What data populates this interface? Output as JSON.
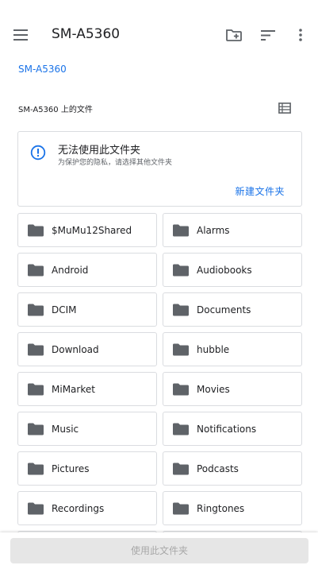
{
  "appbar": {
    "title": "SM-A5360",
    "icons": [
      "menu-icon",
      "new-folder-icon",
      "sort-icon",
      "more-vert-icon"
    ]
  },
  "breadcrumb": "SM-A5360",
  "section": {
    "label": "SM-A5360 上的文件",
    "view_icon": "list-view-icon"
  },
  "notice": {
    "icon": "info-icon",
    "title": "无法使用此文件夹",
    "subtitle": "为保护您的隐私，请选择其他文件夹",
    "action": "新建文件夹"
  },
  "folders": [
    {
      "name": "$MuMu12Shared"
    },
    {
      "name": "Alarms"
    },
    {
      "name": "Android"
    },
    {
      "name": "Audiobooks"
    },
    {
      "name": "DCIM"
    },
    {
      "name": "Documents"
    },
    {
      "name": "Download"
    },
    {
      "name": "hubble"
    },
    {
      "name": "MiMarket"
    },
    {
      "name": "Movies"
    },
    {
      "name": "Music"
    },
    {
      "name": "Notifications"
    },
    {
      "name": "Pictures"
    },
    {
      "name": "Podcasts"
    },
    {
      "name": "Recordings"
    },
    {
      "name": "Ringtones"
    }
  ],
  "bottom_button": "使用此文件夹",
  "colors": {
    "accent": "#1a73e8",
    "icon": "#5f6368",
    "border": "#dadce0",
    "disabled_bg": "#e6e6e6",
    "disabled_text": "#a8a8a8"
  }
}
